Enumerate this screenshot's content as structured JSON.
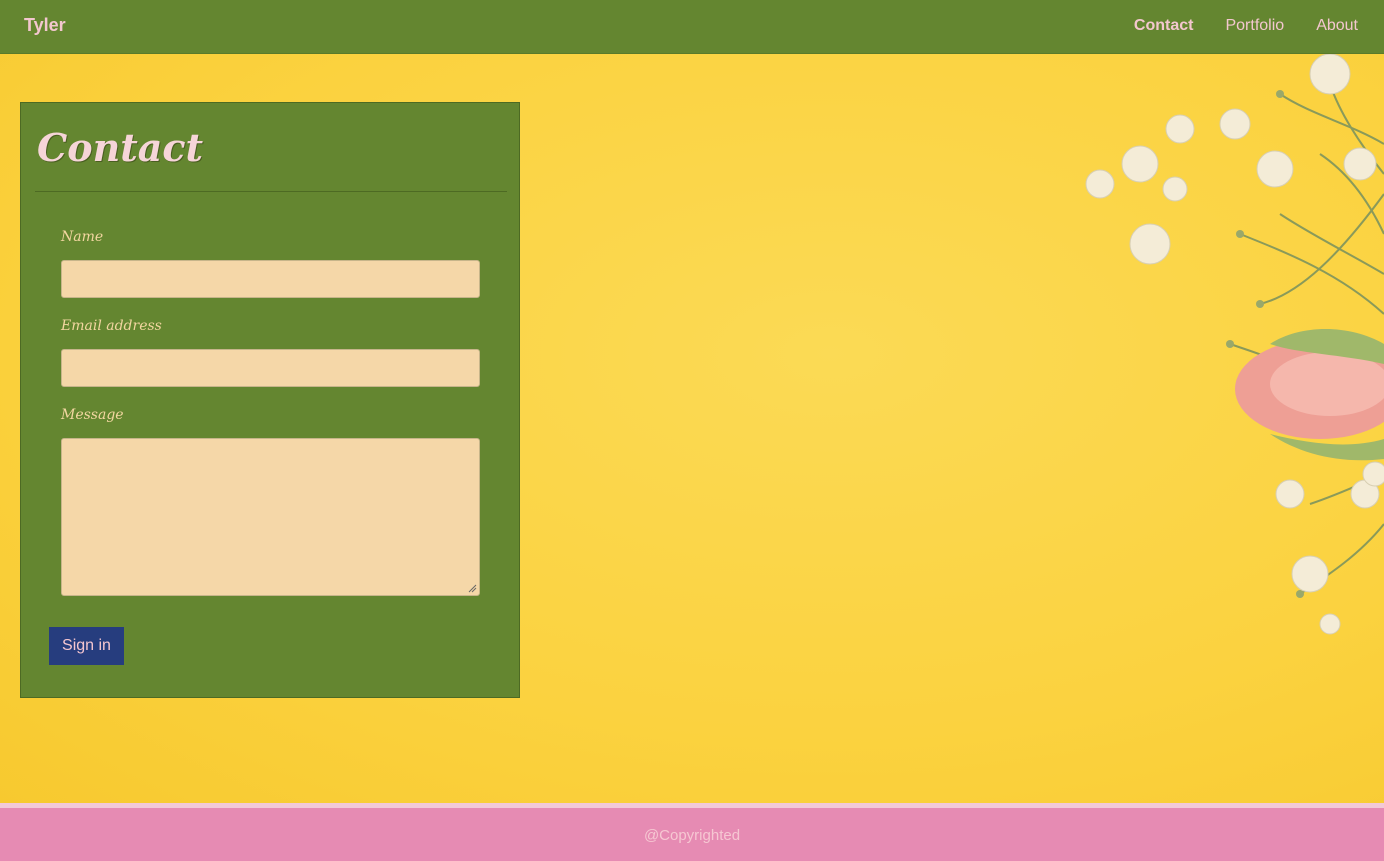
{
  "nav": {
    "brand": "Tyler",
    "links": [
      {
        "label": "Contact",
        "active": true
      },
      {
        "label": "Portfolio",
        "active": false
      },
      {
        "label": "About",
        "active": false
      }
    ]
  },
  "contact_form": {
    "title": "Contact",
    "fields": [
      {
        "label": "Name",
        "value": "",
        "placeholder": ""
      },
      {
        "label": "Email address",
        "value": "",
        "placeholder": ""
      },
      {
        "label": "Message",
        "value": "",
        "placeholder": ""
      }
    ],
    "submit_label": "Sign in"
  },
  "footer": {
    "text": "@Copyrighted"
  },
  "colors": {
    "nav_bg": "#648630",
    "hero_bg": "#fbd23f",
    "card_bg": "#648630",
    "input_bg": "#f5d7a8",
    "button_bg": "#263d7e",
    "footer_bg": "#e68bb3",
    "text_pink": "#f3c7cf"
  }
}
